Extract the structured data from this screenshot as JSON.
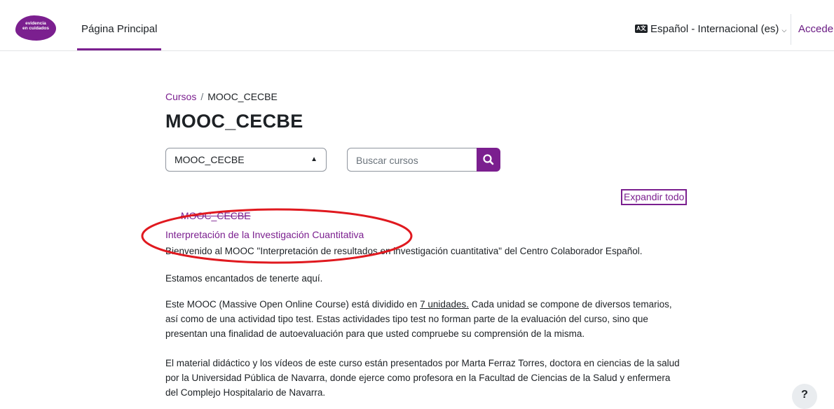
{
  "header": {
    "logo_text_line1": "evidencia",
    "logo_text_line2": "en cuidados",
    "home_label": "Página Principal",
    "language_label": "Español - Internacional (es)",
    "language_icon": "language-icon",
    "login_label": "Acceder"
  },
  "breadcrumb": {
    "items": [
      "Cursos",
      "MOOC_CECBE"
    ],
    "separator": "/"
  },
  "page": {
    "title": "MOOC_CECBE"
  },
  "course_select": {
    "selected": "MOOC_CECBE"
  },
  "search": {
    "placeholder": "Buscar cursos",
    "icon": "search-icon"
  },
  "expand_all_label": "Expandir todo",
  "category": {
    "name": "MOOC_CECBE"
  },
  "course": {
    "name": "Interpretación de la Investigación Cuantitativa",
    "summary": [
      "Bienvenido al MOOC \"Interpretación de resultados en investigación cuantitativa\" del Centro Colaborador Español.",
      "Estamos encantados de tenerte aquí.",
      "El material didáctico y los vídeos de este curso están presentados por Marta Ferraz Torres, doctora en ciencias de la salud por la Universidad Pública de Navarra, donde ejerce como profesora en la Facultad de Ciencias de la Salud y enfermera del Complejo Hospitalario de Navarra."
    ],
    "summary_p3_before": "Este MOOC (Massive Open Online Course) está dividido en ",
    "summary_p3_link": "7 unidades.",
    "summary_p3_after": " Cada unidad se compone de diversos temarios, así como de una actividad tipo test. Estas actividades tipo test no forman parte de la evaluación del curso, sino que presentan una finalidad de autoevaluación para que usted compruebe su comprensión de la misma."
  },
  "help_label": "?",
  "colors": {
    "brand": "#7b1f8f",
    "annotation": "#e0191f",
    "text": "#1d2125"
  }
}
